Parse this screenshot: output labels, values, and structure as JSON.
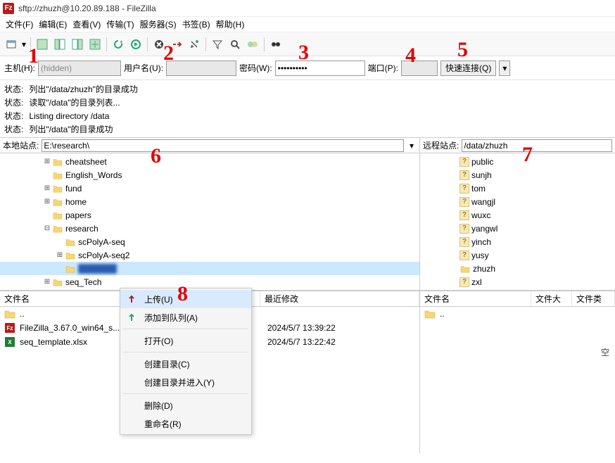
{
  "window": {
    "title": "sftp://zhuzh@10.20.89.188 - FileZilla",
    "app_badge": "Fz"
  },
  "menu": {
    "file": "文件(F)",
    "edit": "编辑(E)",
    "view": "查看(V)",
    "transfer": "传输(T)",
    "server": "服务器(S)",
    "bookmarks": "书签(B)",
    "help": "帮助(H)"
  },
  "quickconnect": {
    "host_label": "主机(H):",
    "host_value": "(hidden)",
    "user_label": "用户名(U):",
    "user_value": "",
    "pass_label": "密码(W):",
    "pass_value": "••••••••••",
    "port_label": "端口(P):",
    "port_value": "",
    "button": "快速连接(Q)"
  },
  "log_status": "状态:",
  "log": [
    "列出\"/data/zhuzh\"的目录成功",
    "读取\"/data\"的目录列表...",
    "Listing directory /data",
    "列出\"/data\"的目录成功"
  ],
  "local": {
    "label": "本地站点:",
    "path": "E:\\research\\",
    "tree": [
      {
        "indent": 3,
        "exp": "+",
        "name": "cheatsheet"
      },
      {
        "indent": 3,
        "exp": "",
        "name": "English_Words"
      },
      {
        "indent": 3,
        "exp": "+",
        "name": "fund"
      },
      {
        "indent": 3,
        "exp": "+",
        "name": "home"
      },
      {
        "indent": 3,
        "exp": "",
        "name": "papers"
      },
      {
        "indent": 3,
        "exp": "-",
        "name": "research"
      },
      {
        "indent": 4,
        "exp": "",
        "name": "scPolyA-seq"
      },
      {
        "indent": 4,
        "exp": "+",
        "name": "scPolyA-seq2"
      },
      {
        "indent": 4,
        "exp": "",
        "name": "GEO",
        "selected": true,
        "blur": true
      },
      {
        "indent": 3,
        "exp": "+",
        "name": "seq_Tech"
      }
    ],
    "list_cols": {
      "name": "文件名",
      "mod": "最近修改"
    },
    "parent": "..",
    "files": [
      {
        "icon": "fz",
        "name": "FileZilla_3.67.0_win64_s...",
        "mod": "2024/5/7 13:39:22"
      },
      {
        "icon": "xls",
        "name": "seq_template.xlsx",
        "mod": "2024/5/7 13:22:42"
      }
    ]
  },
  "remote": {
    "label": "远程站点:",
    "path": "/data/zhuzh",
    "tree": [
      {
        "indent": 2,
        "icon": "unk",
        "name": "public"
      },
      {
        "indent": 2,
        "icon": "unk",
        "name": "sunjh"
      },
      {
        "indent": 2,
        "icon": "unk",
        "name": "tom"
      },
      {
        "indent": 2,
        "icon": "unk",
        "name": "wangjl"
      },
      {
        "indent": 2,
        "icon": "unk",
        "name": "wuxc"
      },
      {
        "indent": 2,
        "icon": "unk",
        "name": "yangwl"
      },
      {
        "indent": 2,
        "icon": "unk",
        "name": "yinch"
      },
      {
        "indent": 2,
        "icon": "unk",
        "name": "yusy"
      },
      {
        "indent": 2,
        "icon": "folder",
        "name": "zhuzh"
      },
      {
        "indent": 2,
        "icon": "unk",
        "name": "zxl"
      }
    ],
    "list_cols": {
      "name": "文件名",
      "size": "文件大小",
      "type": "文件类"
    },
    "parent": "..",
    "empty_hint": "空"
  },
  "context_menu": {
    "upload": "上传(U)",
    "add_queue": "添加到队列(A)",
    "open": "打开(O)",
    "mkdir": "创建目录(C)",
    "mkdir_enter": "创建目录并进入(Y)",
    "delete": "删除(D)",
    "rename": "重命名(R)"
  },
  "annotations": {
    "a1": "1",
    "a2": "2",
    "a3": "3",
    "a4": "4",
    "a5": "5",
    "a6": "6",
    "a7": "7",
    "a8": "8"
  }
}
